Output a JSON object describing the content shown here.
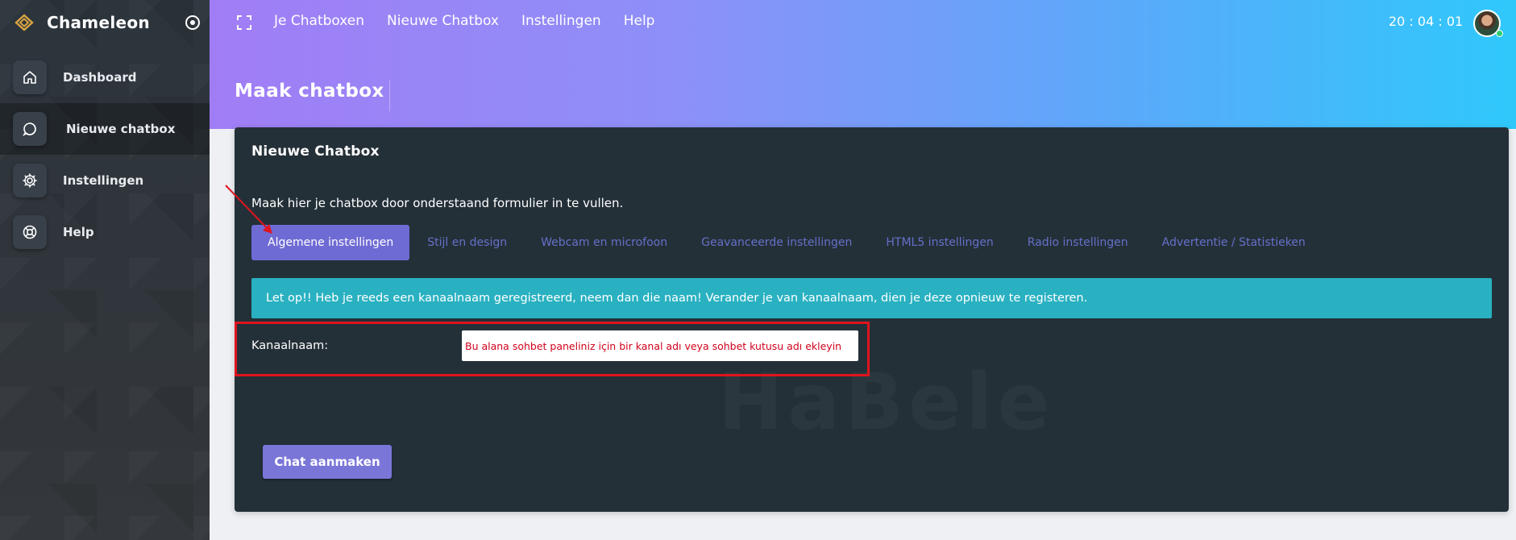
{
  "brand": {
    "name": "Chameleon",
    "accent": "#d9a441"
  },
  "sidebar": {
    "items": [
      {
        "label": "Dashboard",
        "icon": "home-icon",
        "active": false
      },
      {
        "label": "Nieuwe chatbox",
        "icon": "chat-bubble-icon",
        "active": true
      },
      {
        "label": "Instellingen",
        "icon": "gear-icon",
        "active": false
      },
      {
        "label": "Help",
        "icon": "lifebuoy-icon",
        "active": false
      }
    ]
  },
  "topnav": {
    "items": [
      "Je Chatboxen",
      "Nieuwe Chatbox",
      "Instellingen",
      "Help"
    ],
    "clock": "20 : 04 : 01"
  },
  "page": {
    "title": "Maak chatbox"
  },
  "card": {
    "title": "Nieuwe Chatbox",
    "intro": "Maak hier je chatbox door onderstaand formulier in te vullen.",
    "tabs": [
      "Algemene instellingen",
      "Stijl en design",
      "Webcam en microfoon",
      "Geavanceerde instellingen",
      "HTML5 instellingen",
      "Radio instellingen",
      "Advertentie / Statistieken"
    ],
    "active_tab": "Algemene instellingen",
    "alert": "Let op!! Heb je reeds een kanaalnaam geregistreerd, neem dan die naam! Verander je van kanaalnaam, dien je deze opnieuw te registeren.",
    "field": {
      "label": "Kanaalnaam:",
      "value": "Bu alana sohbet paneliniz için bir kanal adı veya sohbet kutusu adı ekleyin"
    },
    "submit_label": "Chat aanmaken"
  },
  "colors": {
    "tab_active": "#6f6bd4",
    "alert_bg": "#29b1c1",
    "highlight_border": "#e0141e",
    "card_bg": "#243038"
  }
}
